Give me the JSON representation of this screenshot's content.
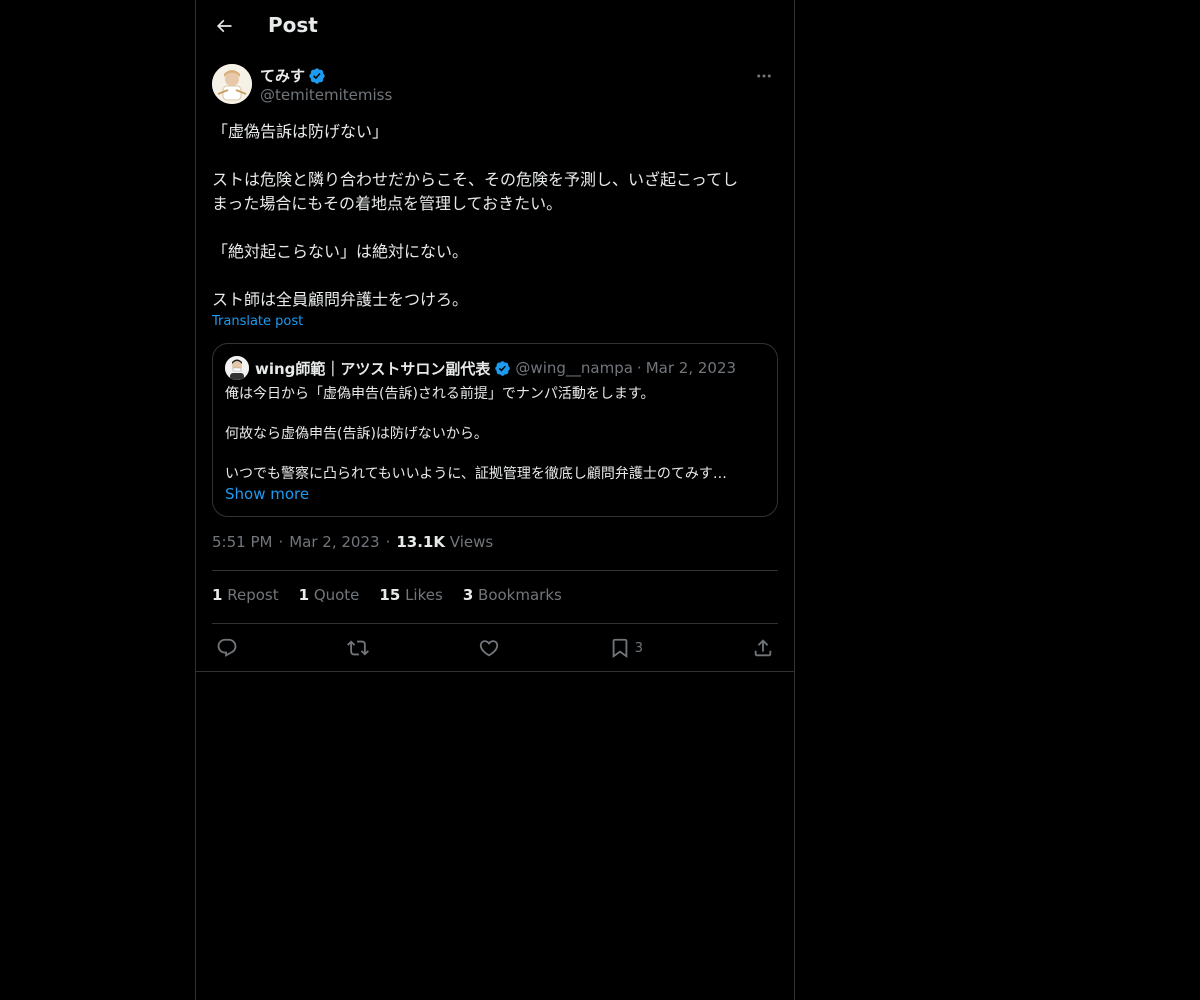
{
  "header": {
    "title": "Post"
  },
  "author": {
    "name": "てみす",
    "handle": "@temitemitemiss"
  },
  "tweet": {
    "paragraphs": [
      [
        "「虚偽告訴は防げない」"
      ],
      [
        "ストは危険と隣り合わせだからこそ、その危険を予測し、いざ起こってし",
        "まった場合にもその着地点を管理しておきたい。"
      ],
      [
        "「絶対起こらない」は絶対にない。"
      ],
      [
        "スト師は全員顧問弁護士をつけろ。"
      ]
    ],
    "translate_label": "Translate post"
  },
  "quote": {
    "name": "wing師範｜アツストサロン副代表",
    "handle": "@wing__nampa",
    "separator": "·",
    "date": "Mar 2, 2023",
    "lines": [
      "俺は今日から「虚偽申告(告訴)される前提」でナンパ活動をします。",
      "何故なら虚偽申告(告訴)は防げないから。",
      "いつでも警察に凸られてもいいように、証拠管理を徹底し顧問弁護士のてみす…"
    ],
    "show_more": "Show more"
  },
  "meta": {
    "time": "5:51 PM",
    "sep1": "·",
    "date": "Mar 2, 2023",
    "sep2": "·",
    "views_count": "13.1K",
    "views_label": "Views"
  },
  "stats": [
    {
      "count": "1",
      "label": "Repost"
    },
    {
      "count": "1",
      "label": "Quote"
    },
    {
      "count": "15",
      "label": "Likes"
    },
    {
      "count": "3",
      "label": "Bookmarks"
    }
  ],
  "actions": {
    "bookmark_count": "3",
    "icons": [
      "reply-icon",
      "repost-icon",
      "like-icon",
      "bookmark-icon",
      "share-icon"
    ]
  },
  "colors": {
    "background": "#000000",
    "text": "#e7e9ea",
    "secondary": "#71767b",
    "accent": "#1d9bf0",
    "border": "#2f3336"
  }
}
